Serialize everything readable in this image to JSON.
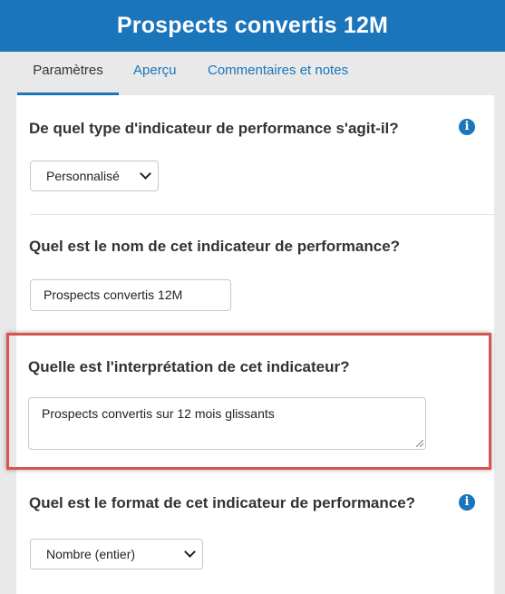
{
  "header": {
    "title": "Prospects convertis 12M"
  },
  "tabs": [
    {
      "label": "Paramètres",
      "active": true
    },
    {
      "label": "Aperçu",
      "active": false
    },
    {
      "label": "Commentaires et notes",
      "active": false
    }
  ],
  "form": {
    "q1": {
      "question": "De quel type d'indicateur de performance s'agit-il?",
      "value": "Personnalisé"
    },
    "q2": {
      "question": "Quel est le nom de cet indicateur de performance?",
      "value": "Prospects convertis 12M"
    },
    "q3": {
      "question": "Quelle est l'interprétation de cet indicateur?",
      "value": "Prospects convertis sur 12 mois glissants"
    },
    "q4": {
      "question": "Quel est le format de cet indicateur de performance?",
      "value": "Nombre (entier)"
    }
  },
  "icons": {
    "info": "i"
  },
  "colors": {
    "brand": "#1a75bb",
    "highlight": "#d9534f"
  }
}
